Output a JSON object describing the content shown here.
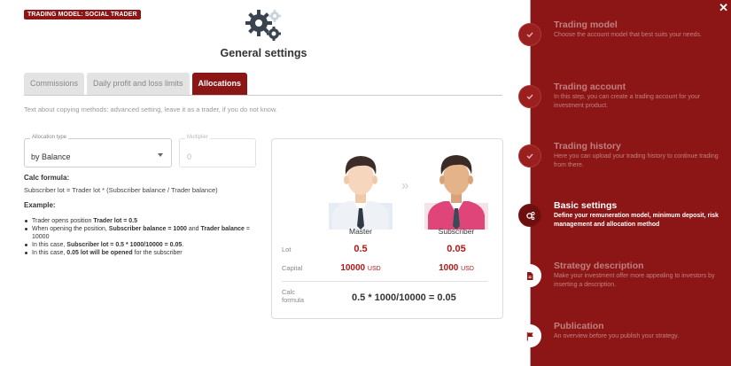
{
  "badge": "TRADING MODEL: SOCIAL TRADER",
  "title": "General settings",
  "tabs": [
    {
      "label": "Commissions",
      "active": false
    },
    {
      "label": "Daily profit and loss limits",
      "active": false
    },
    {
      "label": "Allocations",
      "active": true
    }
  ],
  "description": "Text about copying methods: advanced setting, leave it as a trader, if you do not know.",
  "allocation": {
    "label": "Allocation type",
    "value": "by Balance"
  },
  "multiplier": {
    "label": "Multiplier",
    "placeholder": "0"
  },
  "calc": {
    "heading": "Calc formula:",
    "text": "Subscriber lot = Trader lot * (Subscriber balance / Trader balance)"
  },
  "example": {
    "heading": "Example:",
    "items": [
      [
        {
          "t": "Trader opens position ",
          "b": false
        },
        {
          "t": "Trader lot = 0.5",
          "b": true
        }
      ],
      [
        {
          "t": "When opening the position, ",
          "b": false
        },
        {
          "t": "Subscriber balance = 1000",
          "b": true
        },
        {
          "t": " and ",
          "b": false
        },
        {
          "t": "Trader balance",
          "b": true
        },
        {
          "t": " = 10000",
          "b": false
        }
      ],
      [
        {
          "t": "In this case, ",
          "b": false
        },
        {
          "t": "Subscriber lot = 0.5 * 1000/10000 = 0.05",
          "b": true
        },
        {
          "t": ".",
          "b": false
        }
      ],
      [
        {
          "t": "In this case, ",
          "b": false
        },
        {
          "t": "0.05 lot will be opened",
          "b": true
        },
        {
          "t": " for the subscriber",
          "b": false
        }
      ]
    ]
  },
  "card": {
    "master_label": "Master",
    "subscriber_label": "Subscriber",
    "lot_label": "Lot",
    "capital_label": "Capital",
    "calc_label": "Calc formula",
    "master_lot": "0.5",
    "subscriber_lot": "0.05",
    "master_capital": "10000",
    "subscriber_capital": "1000",
    "currency": "USD",
    "formula": "0.5 * 1000/10000 = 0.05",
    "arrow": "»"
  },
  "close_icon": "✕",
  "steps": [
    {
      "title": "Trading model",
      "desc": "Choose the account model that best suits your needs.",
      "state": "done",
      "icon": "check-icon"
    },
    {
      "title": "Trading account",
      "desc": "In this step, you can create a trading account for your investment product.",
      "state": "done",
      "icon": "check-icon"
    },
    {
      "title": "Trading history",
      "desc": "Here you can upload your trading history to continue trading from there.",
      "state": "done",
      "icon": "check-icon"
    },
    {
      "title": "Basic settings",
      "desc": "Define your remuneration model, minimum deposit, risk management and allocation method",
      "state": "current",
      "icon": "gears-icon"
    },
    {
      "title": "Strategy description",
      "desc": "Make your investment offer more appealing to investors by inserting a description.",
      "state": "todo",
      "icon": "document-icon"
    },
    {
      "title": "Publication",
      "desc": "An overview before you publish your strategy.",
      "state": "todo",
      "icon": "flag-icon"
    }
  ],
  "colors": {
    "accent": "#8c1515",
    "value": "#b01818"
  }
}
